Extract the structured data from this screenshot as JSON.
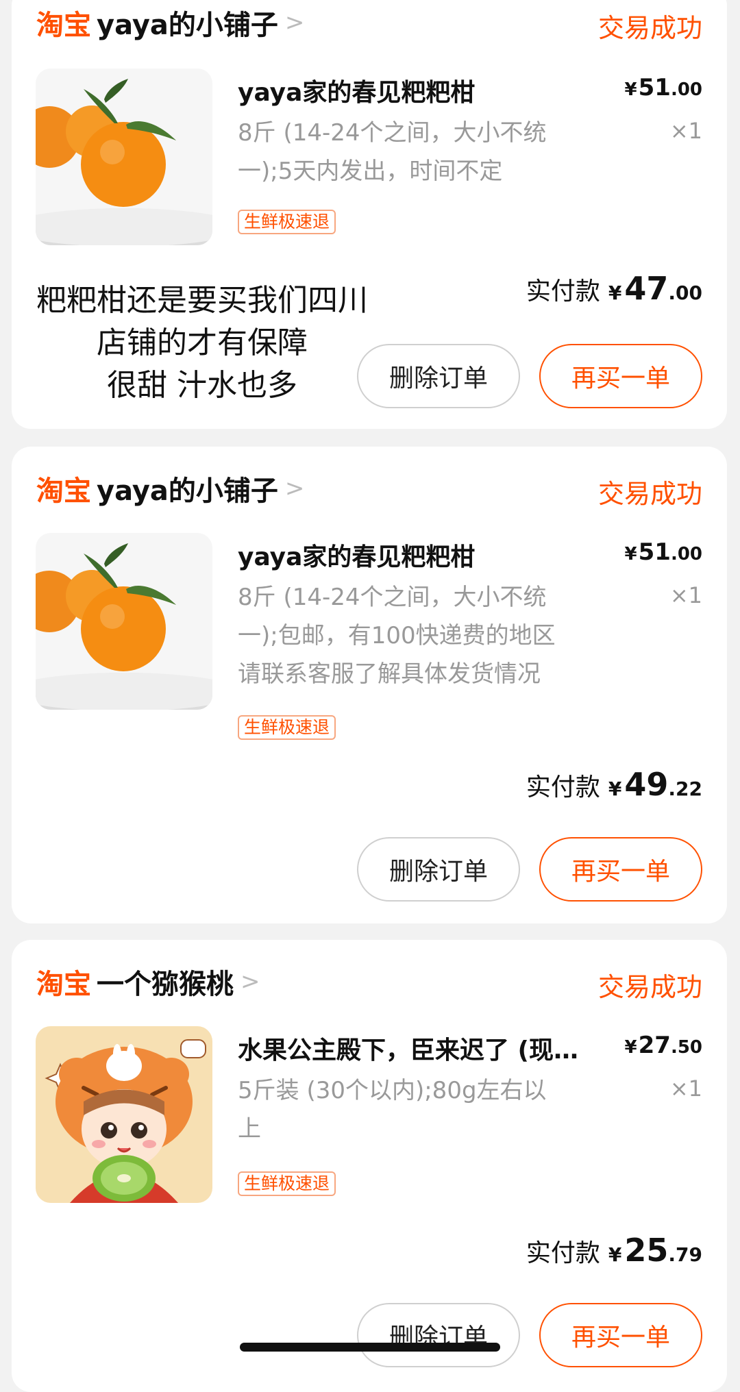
{
  "orders": [
    {
      "brand": "淘宝",
      "shop": "yaya的小铺子",
      "status": "交易成功",
      "title": "yaya家的春见粑粑柑",
      "price_currency": "¥",
      "price_int": "51",
      "price_dec": ".00",
      "desc_line1": "8斤 (14-24个之间，大小不统",
      "desc_line2": "一);5天内发出，时间不定",
      "desc_line3": "",
      "qty": "×1",
      "tag": "生鲜极速退",
      "paid_label": "实付款",
      "paid_currency": "¥",
      "paid_int": "47",
      "paid_dec": ".00",
      "delete_label": "删除订单",
      "rebuy_label": "再买一单",
      "thumb_icon": "orange-fruit-photo"
    },
    {
      "brand": "淘宝",
      "shop": "yaya的小铺子",
      "status": "交易成功",
      "title": "yaya家的春见粑粑柑",
      "price_currency": "¥",
      "price_int": "51",
      "price_dec": ".00",
      "desc_line1": "8斤 (14-24个之间，大小不统",
      "desc_line2": "一);包邮，有100快递费的地区",
      "desc_line3": "请联系客服了解具体发货情况",
      "qty": "×1",
      "tag": "生鲜极速退",
      "paid_label": "实付款",
      "paid_currency": "¥",
      "paid_int": "49",
      "paid_dec": ".22",
      "delete_label": "删除订单",
      "rebuy_label": "再买一单",
      "thumb_icon": "orange-fruit-photo"
    },
    {
      "brand": "淘宝",
      "shop": "一个猕猴桃",
      "status": "交易成功",
      "title": "水果公主殿下，臣来迟了 (现…",
      "price_currency": "¥",
      "price_int": "27",
      "price_dec": ".50",
      "desc_line1": "5斤装 (30个以内);80g左右以",
      "desc_line2": "上",
      "desc_line3": "",
      "qty": "×1",
      "tag": "生鲜极速退",
      "paid_label": "实付款",
      "paid_currency": "¥",
      "paid_int": "25",
      "paid_dec": ".79",
      "delete_label": "删除订单",
      "rebuy_label": "再买一单",
      "thumb_icon": "kiwi-girl-illustration"
    }
  ],
  "overlay_text": {
    "line1": "粑粑柑还是要买我们四川",
    "line2": "店铺的才有保障",
    "line3": "很甜 汁水也多"
  },
  "colors": {
    "accent": "#ff5000",
    "background": "#f2f2f2",
    "card": "#ffffff",
    "muted_text": "#999999"
  }
}
